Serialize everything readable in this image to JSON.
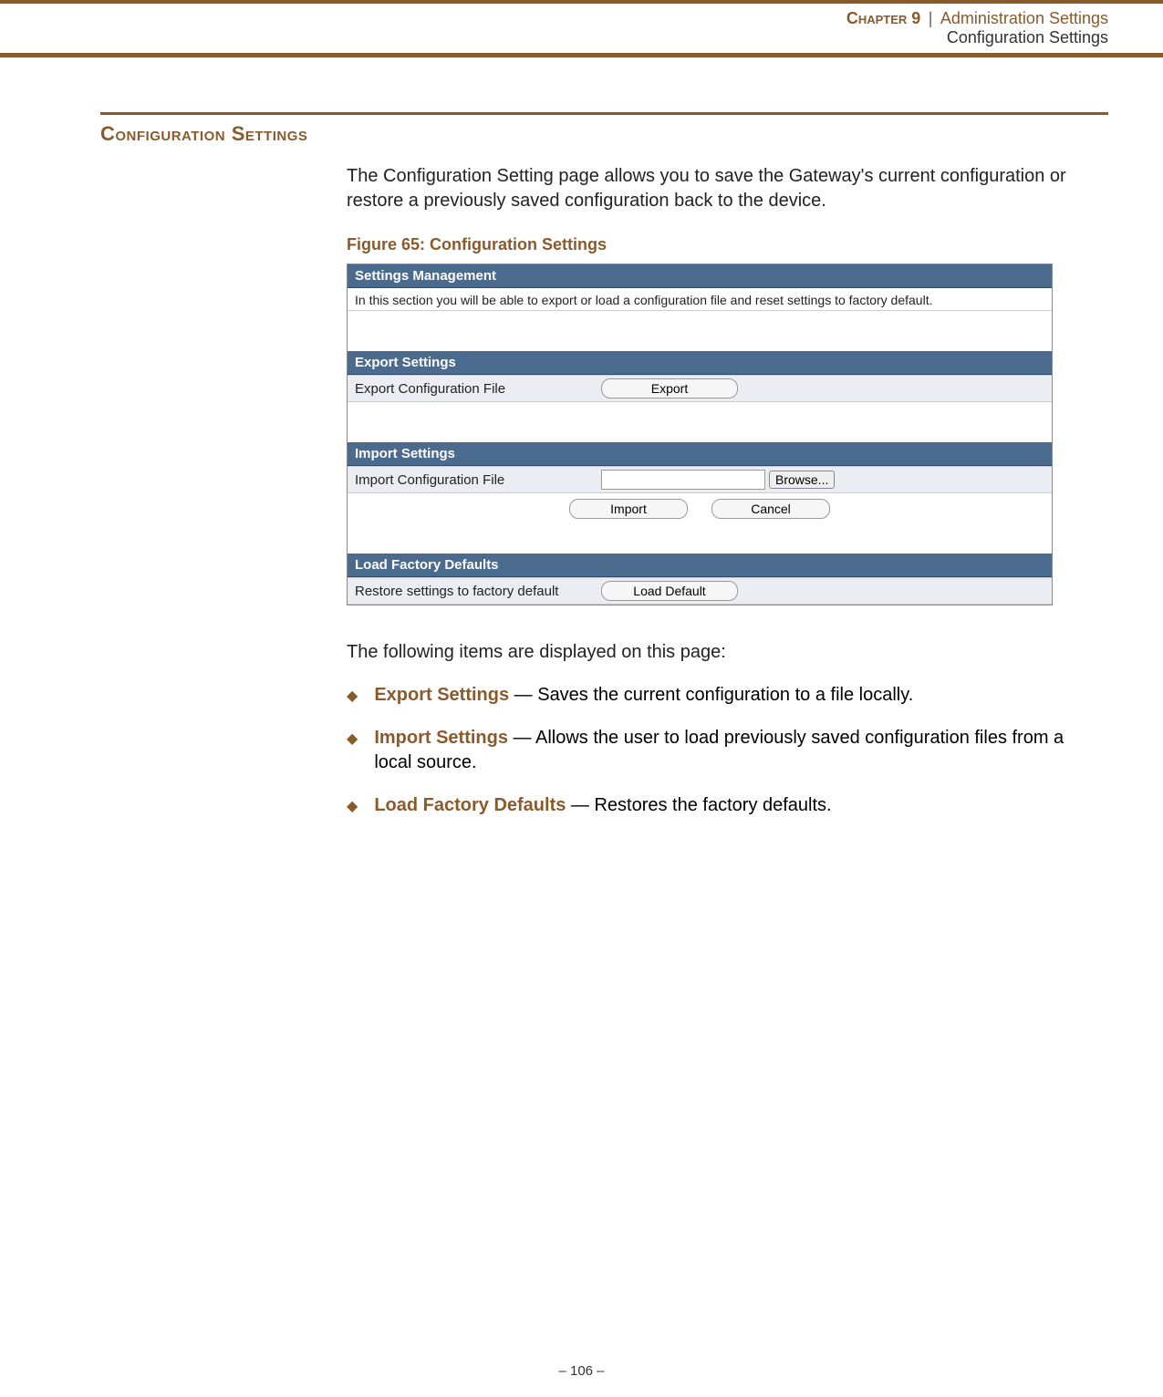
{
  "header": {
    "chapter_label": "Chapter 9",
    "separator": "|",
    "title": "Administration Settings",
    "subtitle": "Configuration Settings"
  },
  "section": {
    "heading": "Configuration Settings",
    "intro": "The Configuration Setting page allows you to save the Gateway's current configuration or restore a previously saved configuration back to the device.",
    "figure_caption": "Figure 65:  Configuration Settings"
  },
  "screenshot": {
    "mgmt_header": "Settings Management",
    "mgmt_desc": "In this section you will be able to export or load a configuration file and reset settings to factory default.",
    "export_header": "Export Settings",
    "export_label": "Export Configuration File",
    "export_btn": "Export",
    "import_header": "Import Settings",
    "import_label": "Import Configuration File",
    "browse_btn": "Browse...",
    "import_btn": "Import",
    "cancel_btn": "Cancel",
    "factory_header": "Load Factory Defaults",
    "factory_label": "Restore settings to factory default",
    "factory_btn": "Load Default"
  },
  "items_intro": "The following items are displayed on this page:",
  "bullets": [
    {
      "label": "Export Settings",
      "text": " — Saves the current configuration to a file locally."
    },
    {
      "label": "Import Settings",
      "text": " — Allows the user to load previously saved configuration files from a local source."
    },
    {
      "label": "Load Factory Defaults",
      "text": " — Restores the factory defaults."
    }
  ],
  "footer": {
    "page_number": "–  106  –"
  }
}
